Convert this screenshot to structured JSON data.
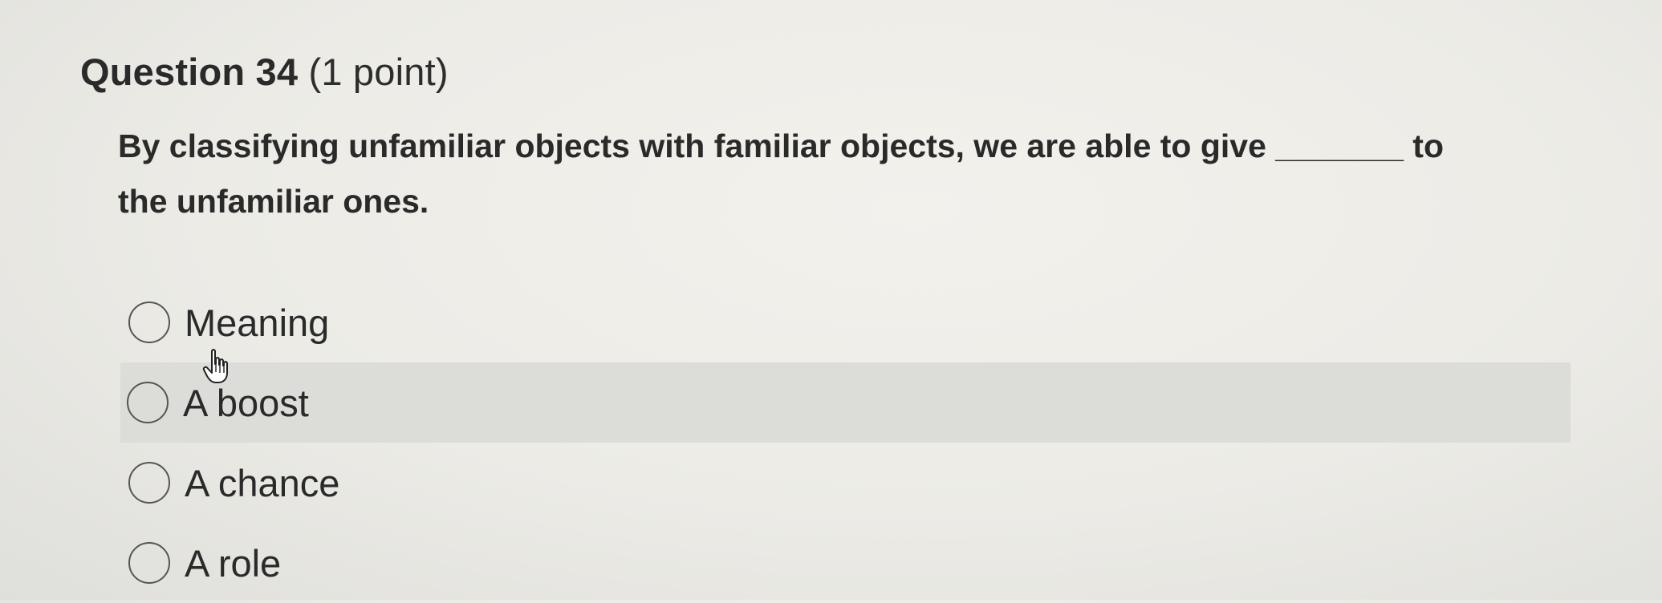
{
  "question": {
    "number_label": "Question 34",
    "points_label": "(1 point)",
    "text_line_1": "By classifying unfamiliar objects with familiar objects, we are able to give _______ to",
    "text_line_2": "the unfamiliar ones."
  },
  "choices": [
    {
      "label": "Meaning",
      "selected": false
    },
    {
      "label": "A boost",
      "selected": false,
      "hovered": true
    },
    {
      "label": "A chance",
      "selected": false
    },
    {
      "label": "A role",
      "selected": false
    }
  ],
  "icons": {
    "radio": "radio-button-icon",
    "cursor": "hand-pointer-icon"
  },
  "colors": {
    "text": "#2a2a2a",
    "hover_background": "#dcdcd8",
    "radio_border": "#555555"
  }
}
